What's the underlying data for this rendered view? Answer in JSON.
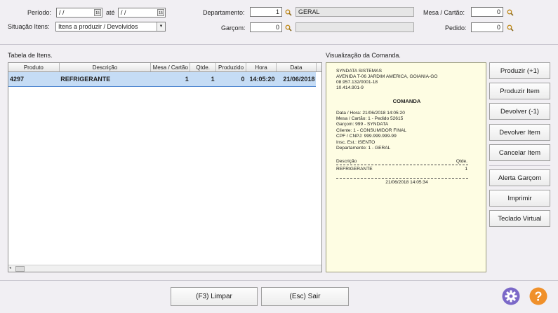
{
  "filters": {
    "periodo_label": "Período:",
    "periodo_from": " / /",
    "ate_label": "até",
    "periodo_to": " / /",
    "situacao_label": "Situação Itens:",
    "situacao_value": "Itens a produzir / Devolvidos",
    "departamento_label": "Departamento:",
    "departamento_code": "1",
    "departamento_name": "GERAL",
    "garcom_label": "Garçom:",
    "garcom_code": "0",
    "garcom_name": "",
    "mesa_label": "Mesa / Cartão:",
    "mesa_value": "0",
    "pedido_label": "Pedido:",
    "pedido_value": "0"
  },
  "table": {
    "title": "Tabela de Itens.",
    "columns": [
      "Produto",
      "Descrição",
      "Mesa / Cartão",
      "Qtde.",
      "Produzido",
      "Hora",
      "Data"
    ],
    "rows": [
      {
        "produto": "4297",
        "descricao": "REFRIGERANTE",
        "mesa": "1",
        "qtde": "1",
        "produzido": "0",
        "hora": "14:05:20",
        "data": "21/06/2018"
      }
    ]
  },
  "comanda": {
    "title": "Visualização da Comanda.",
    "company_lines": [
      "SYNDATA SISTEMAS",
      "AVENIDA T-06 JARDIM AMERICA, GOIANIA-GO",
      "08.957.132/0001-18",
      "10.414.901-9"
    ],
    "heading": "COMANDA",
    "info_lines": [
      "Data / Hora: 21/06/2018 14:05:20",
      "Mesa / Cartão: 1 - Pedido 52615",
      "Garçom: 999 - SYNDATA",
      "Cliente: 1 - CONSUMIDOR FINAL",
      "CPF / CNPJ: 999.999.999-99",
      "Insc. Est.: ISENTO",
      "Departamento: 1 - GERAL"
    ],
    "col_desc": "Descrição",
    "col_qtde": "Qtde.",
    "item_desc": "REFRIGERANTE",
    "item_qtde": "1",
    "footer": "21/06/2018 14:05:34"
  },
  "actions": {
    "produzir_1": "Produzir (+1)",
    "produzir_item": "Produzir Item",
    "devolver_1": "Devolver (-1)",
    "devolver_item": "Devolver Item",
    "cancelar_item": "Cancelar Item",
    "alerta_garcom": "Alerta Garçom",
    "imprimir": "Imprimir",
    "teclado": "Teclado Virtual"
  },
  "bottom": {
    "limpar": "(F3) Limpar",
    "sair": "(Esc) Sair"
  },
  "colors": {
    "settings_icon": "#7b68c8",
    "help_icon": "#f0902a",
    "row_highlight": "#c5dcf5",
    "comanda_bg": "#fefde3"
  },
  "icons": [
    "search-icon",
    "calendar-icon",
    "chevron-down-icon",
    "gear-icon",
    "help-icon"
  ]
}
